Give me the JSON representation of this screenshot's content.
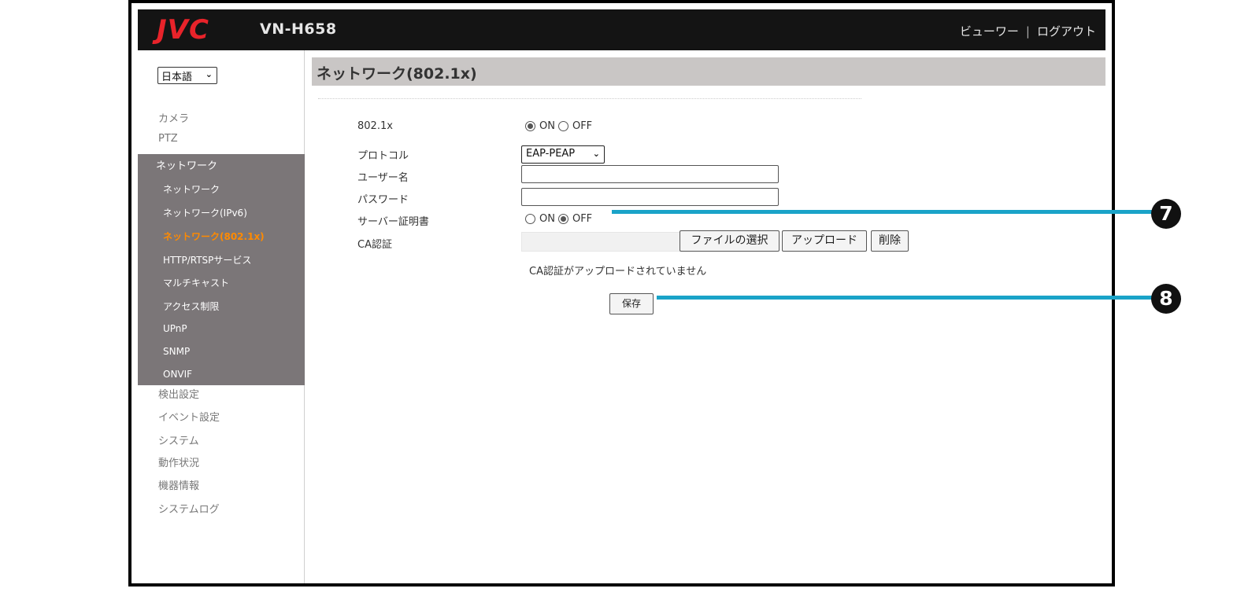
{
  "header": {
    "logo": "JVC",
    "model": "VN-H658",
    "viewer_link": "ビューワー",
    "separator": "|",
    "logout_link": "ログアウト"
  },
  "sidebar": {
    "language": "日本語",
    "items_top": [
      "カメラ",
      "PTZ"
    ],
    "network_header": "ネットワーク",
    "network_sub": [
      "ネットワーク",
      "ネットワーク(IPv6)",
      "ネットワーク(802.1x)",
      "HTTP/RTSPサービス",
      "マルチキャスト",
      "アクセス制限",
      "UPnP",
      "SNMP",
      "ONVIF"
    ],
    "active_sub": "ネットワーク(802.1x)",
    "items_bottom": [
      "検出設定",
      "イベント設定",
      "システム",
      "動作状況",
      "機器情報",
      "システムログ"
    ]
  },
  "main": {
    "title": "ネットワーク(802.1x)",
    "fields": {
      "dot1x_label": "802.1x",
      "protocol_label": "プロトコル",
      "username_label": "ユーザー名",
      "password_label": "パスワード",
      "server_cert_label": "サーバー証明書",
      "ca_label": "CA認証"
    },
    "dot1x": {
      "on": "ON",
      "off": "OFF",
      "selected": "ON"
    },
    "server_cert": {
      "on": "ON",
      "off": "OFF",
      "selected": "OFF"
    },
    "protocol_value": "EAP-PEAP",
    "username_value": "",
    "password_value": "",
    "buttons": {
      "choose_file": "ファイルの選択",
      "upload": "アップロード",
      "delete": "削除",
      "save": "保存"
    },
    "ca_status": "CA認証がアップロードされていません"
  },
  "callouts": [
    "7",
    "8"
  ],
  "colors": {
    "accent_line": "#1aa3c8",
    "active_menu": "#ff8a00",
    "logo": "#e8232a",
    "header_bg": "#141414"
  },
  "icons": {
    "select_chevron": "chevron-down-icon"
  }
}
